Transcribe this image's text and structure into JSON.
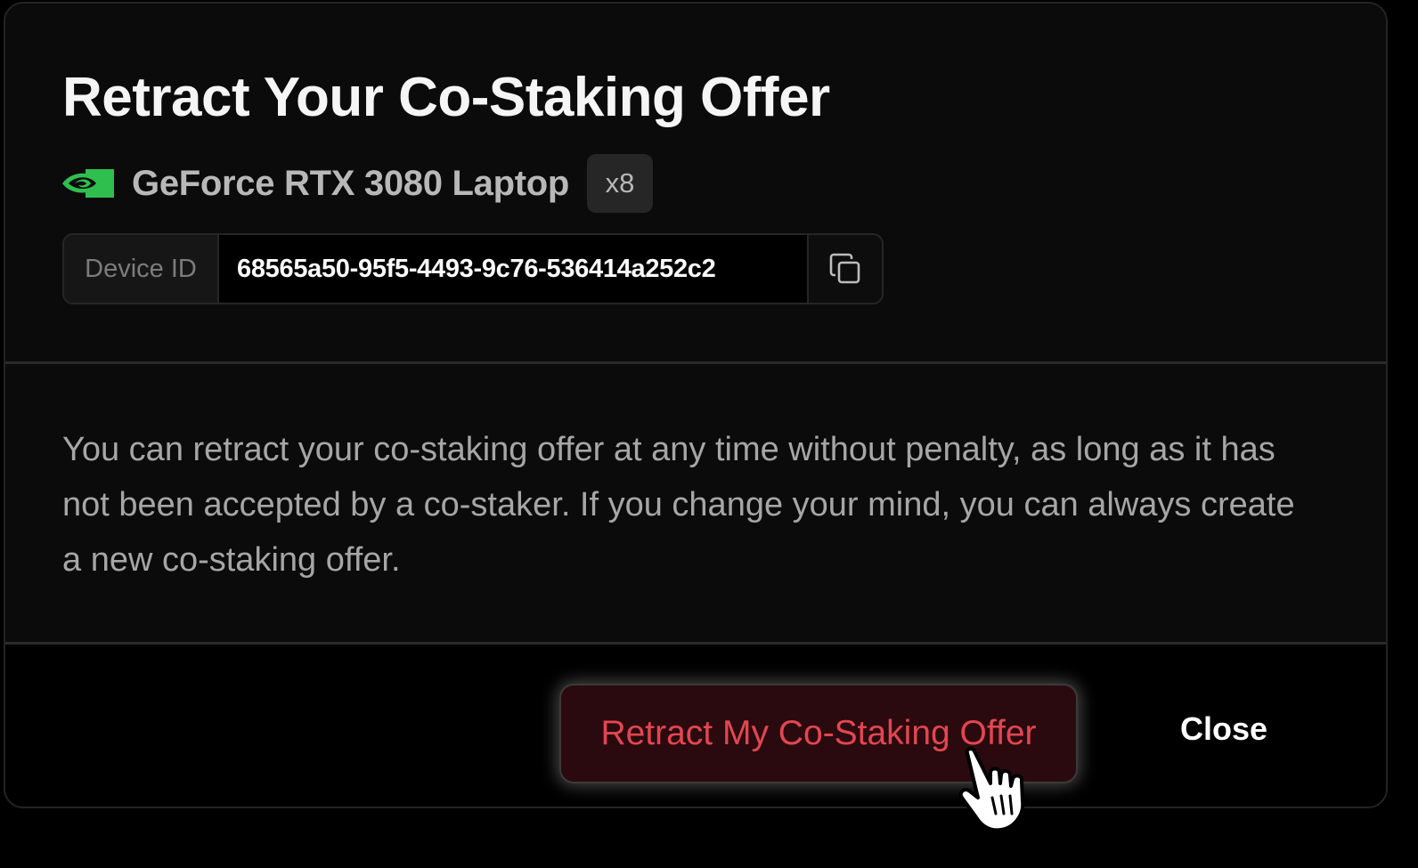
{
  "modal": {
    "title": "Retract Your Co-Staking Offer",
    "device": {
      "brand_icon": "nvidia-logo-icon",
      "brand_color": "#76b900",
      "name": "GeForce RTX 3080 Laptop",
      "count": "x8"
    },
    "device_id": {
      "label": "Device ID",
      "value": "68565a50-95f5-4493-9c76-536414a252c2",
      "copy_icon": "copy-icon"
    },
    "description": "You can retract your co-staking offer at any time without penalty, as long as it has not been accepted by a co-staker. If you change your mind, you can always create a new co-staking offer.",
    "actions": {
      "retract_label": "Retract My Co-Staking Offer",
      "retract_color": "#e24651",
      "close_label": "Close"
    }
  },
  "cursor": {
    "icon": "hand-pointer-icon"
  }
}
